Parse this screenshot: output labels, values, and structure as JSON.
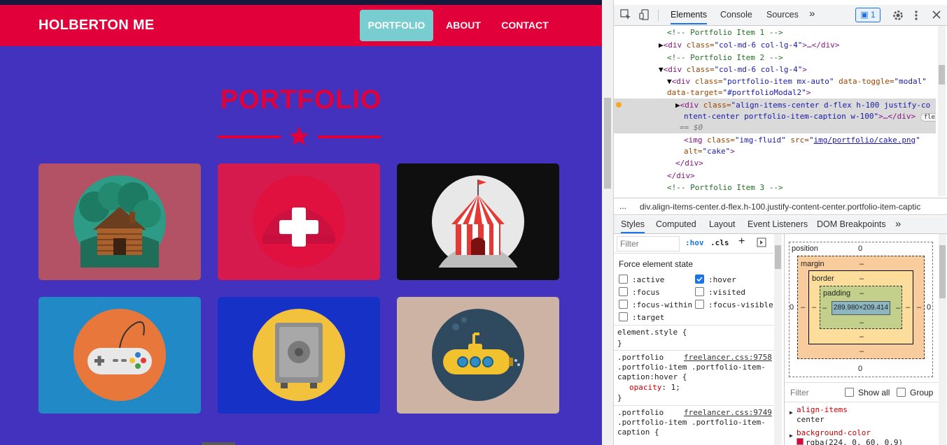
{
  "site": {
    "brand": "HOLBERTON ME",
    "nav": [
      {
        "label": "PORTFOLIO",
        "active": true
      },
      {
        "label": "ABOUT",
        "active": false
      },
      {
        "label": "CONTACT",
        "active": false
      }
    ],
    "section_title": "PORTFOLIO",
    "colors": {
      "primary": "#e2003a",
      "background": "#4232be",
      "active_nav": "#78cdd1"
    },
    "portfolio_items": [
      {
        "icon": "cabin-icon",
        "bg": "#b25264"
      },
      {
        "icon": "cake-icon",
        "bg": "#d61a4e"
      },
      {
        "icon": "circus-tent-icon",
        "bg": "#0f0f10"
      },
      {
        "icon": "game-controller-icon",
        "bg": "#2289c7"
      },
      {
        "icon": "safe-icon",
        "bg": "#1632c6"
      },
      {
        "icon": "submarine-icon",
        "bg": "#cdb3a3"
      }
    ]
  },
  "devtools": {
    "tabs": [
      "Elements",
      "Console",
      "Sources"
    ],
    "issues_count": "1",
    "dom": {
      "c1": "<!-- Portfolio Item 1 -->",
      "l2_open": "<div ",
      "l2_attr": "class=",
      "l2_val": "\"col-md-6 col-lg-4\"",
      "l2_close": ">…</div>",
      "c2": "<!-- Portfolio Item 2 -->",
      "l4_open": "<div ",
      "l4_attr": "class=",
      "l4_val": "\"col-md-6 col-lg-4\"",
      "l4_close": ">",
      "l5_open": "<div ",
      "l5_attr1": "class=",
      "l5_val1": "\"portfolio-item mx-auto\"",
      "l5_attr2": " data-toggle=",
      "l5_val2": "\"modal\"",
      "l6_attr": "data-target=",
      "l6_val": "\"#portfolioModal2\"",
      "l6_close": ">",
      "l7_open": "<div ",
      "l7_attr": "class=",
      "l7_val": "\"align-items-center d-flex h-100 justify-co",
      "l8_val": "ntent-center portfolio-item-caption w-100\"",
      "l8_close": ">…</div>",
      "l8_badge": "flex",
      "l9": "== $0",
      "l10_open": "<img ",
      "l10_attr1": "class=",
      "l10_val1": "\"img-fluid\"",
      "l10_attr2": " src=",
      "l10_link": "img/portfolio/cake.png",
      "l11_attr": "alt=",
      "l11_val": "\"cake\"",
      "l11_close": ">",
      "l12": "</div>",
      "l13": "</div>",
      "c3": "<!-- Portfolio Item 3 -->"
    },
    "breadcrumb_dots": "...",
    "breadcrumb": "div.align-items-center.d-flex.h-100.justify-content-center.portfolio-item-captic",
    "sub_tabs": [
      "Styles",
      "Computed",
      "Layout",
      "Event Listeners",
      "DOM Breakpoints"
    ],
    "filter_placeholder": "Filter",
    "hov": ":hov",
    "cls": ".cls",
    "force_state_title": "Force element state",
    "states_left": [
      ":active",
      ":focus",
      ":focus-within",
      ":target"
    ],
    "states_right": [
      ":hover",
      ":visited",
      ":focus-visible"
    ],
    "element_style": "element.style {",
    "close_brace": "}",
    "rule1": {
      "sel1": ".portfolio",
      "src": "freelancer.css:9758",
      "sel2": ".portfolio-item .portfolio-item-",
      "sel3": "caption:hover {",
      "prop": "opacity",
      "val": "1;"
    },
    "rule2": {
      "sel1": ".portfolio",
      "src": "freelancer.css:9749",
      "sel2": ".portfolio-item .portfolio-item-",
      "sel3": "caption {"
    },
    "box_model": {
      "position_label": "position",
      "position_val": "0",
      "margin_label": "margin",
      "margin_val": "–",
      "border_label": "border",
      "border_val": "–",
      "padding_label": "padding",
      "padding_val": "–",
      "content": "289.980×209.414",
      "side_zero": "0"
    },
    "computed_filter": "Filter",
    "show_all": "Show all",
    "group": "Group",
    "computed": [
      {
        "prop": "align-items",
        "val": "center"
      },
      {
        "prop": "background-color",
        "val": "rgba(224, 0, 60, 0.9)"
      }
    ]
  }
}
